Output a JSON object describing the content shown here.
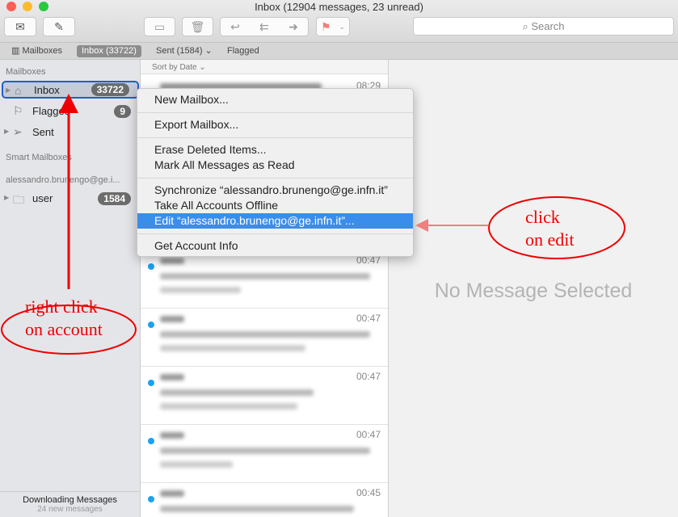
{
  "window": {
    "title": "Inbox (12904 messages, 23 unread)"
  },
  "toolbar": {
    "search_placeholder": "Search",
    "icons": [
      "get-mail-icon",
      "compose-icon",
      "archive-icon",
      "trash-icon",
      "reply-icon",
      "reply-all-icon",
      "forward-icon",
      "flag-icon",
      "chevron-down-icon"
    ]
  },
  "favorites": {
    "mailboxes": "Mailboxes",
    "inbox": "Inbox (33722)",
    "sent": "Sent (1584)",
    "flagged": "Flagged"
  },
  "sidebar": {
    "mailboxes_header": "Mailboxes",
    "inbox": {
      "label": "Inbox",
      "count": "33722"
    },
    "flagged": {
      "label": "Flagged",
      "count": "9"
    },
    "sent": {
      "label": "Sent"
    },
    "smart_header": "Smart Mailboxes",
    "account_header": "alessandro.brunengo@ge.i...",
    "user": {
      "label": "user",
      "count": "1584"
    },
    "status": "Downloading Messages",
    "status_sub": "24 new messages"
  },
  "list": {
    "sort": "Sort by Date",
    "times": [
      "08:29",
      "",
      "",
      "00:47",
      "00:47",
      "00:47",
      "00:47",
      "00:45"
    ]
  },
  "detail": {
    "empty": "No Message Selected"
  },
  "context_menu": {
    "items": [
      "New Mailbox...",
      "Export Mailbox...",
      "Erase Deleted Items...",
      "Mark All Messages as Read",
      "Synchronize “alessandro.brunengo@ge.infn.it”",
      "Take All Accounts Offline",
      "Edit “alessandro.brunengo@ge.infn.it”...",
      "Get Account Info"
    ],
    "highlighted": 6
  },
  "annotations": {
    "left_line1": "right click",
    "left_line2": "on account",
    "right_line1": "click",
    "right_line2": "on edit",
    "color": "#e00000"
  }
}
